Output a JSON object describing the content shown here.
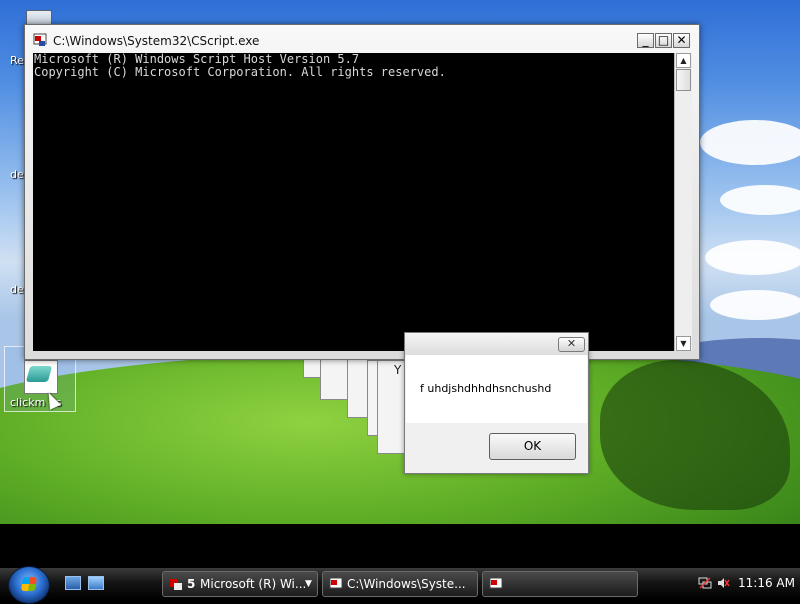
{
  "desktop": {
    "icons": [
      {
        "name": "recycle-bin",
        "label": "Re"
      },
      {
        "name": "desktop-item-1",
        "label": "de"
      },
      {
        "name": "desktop-item-2",
        "label": "de"
      },
      {
        "name": "vbs-file",
        "label": "clickm   bs"
      }
    ]
  },
  "console": {
    "title": "C:\\Windows\\System32\\CScript.exe",
    "lines": [
      "Microsoft (R) Windows Script Host Version 5.7",
      "Copyright (C) Microsoft Corporation. All rights reserved."
    ],
    "buttons": {
      "minimize": "_",
      "maximize": "□",
      "close": "✕"
    },
    "scroll": {
      "up": "▲",
      "down": "▼"
    }
  },
  "msgbox": {
    "message": "f uhdjshdhhdhsnchushd",
    "ok_label": "OK",
    "close_glyph": "✕"
  },
  "ghost_letter": "Y",
  "taskbar": {
    "buttons": [
      {
        "count": "5",
        "label": "Microsoft (R) Wi..."
      },
      {
        "label": "C:\\Windows\\Syste..."
      },
      {
        "label": ""
      }
    ],
    "clock": "11:16 AM"
  },
  "colors": {
    "console_bg": "#000000",
    "console_text": "#d8d8d8",
    "taskbar_bg": "#141414",
    "accent": "#2b6fd0"
  }
}
